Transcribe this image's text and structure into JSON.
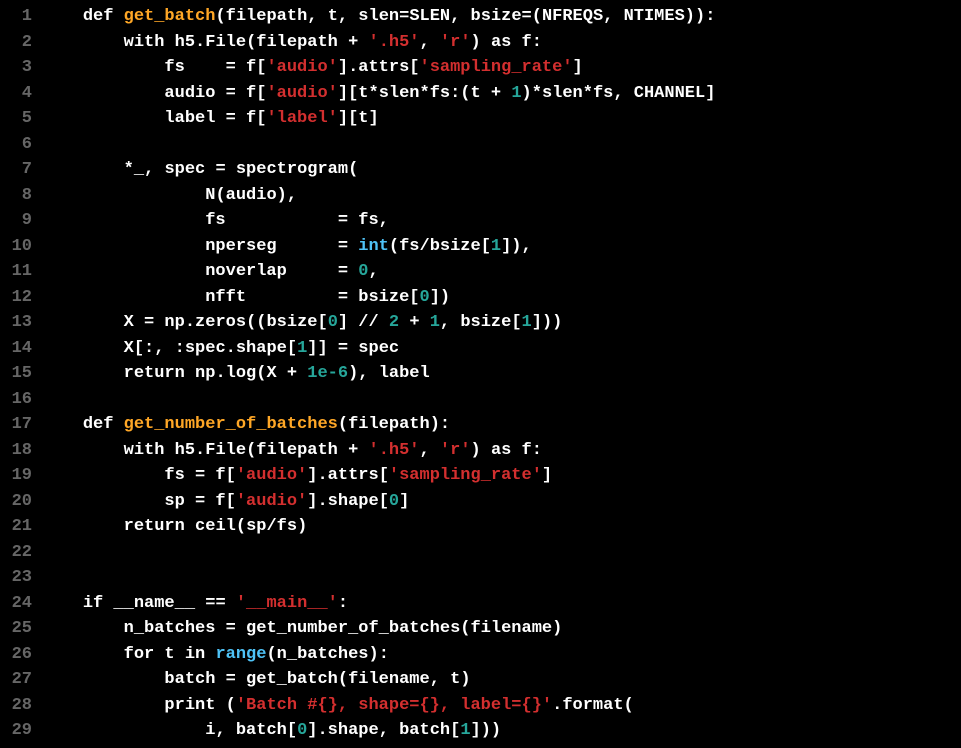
{
  "lines": [
    {
      "n": "1",
      "tokens": [
        {
          "c": "id",
          "t": "    "
        },
        {
          "c": "kw",
          "t": "def"
        },
        {
          "c": "id",
          "t": " "
        },
        {
          "c": "fn",
          "t": "get_batch"
        },
        {
          "c": "punc",
          "t": "("
        },
        {
          "c": "id",
          "t": "filepath"
        },
        {
          "c": "punc",
          "t": ", "
        },
        {
          "c": "id",
          "t": "t"
        },
        {
          "c": "punc",
          "t": ", "
        },
        {
          "c": "id",
          "t": "slen"
        },
        {
          "c": "op",
          "t": "="
        },
        {
          "c": "id",
          "t": "SLEN"
        },
        {
          "c": "punc",
          "t": ", "
        },
        {
          "c": "id",
          "t": "bsize"
        },
        {
          "c": "op",
          "t": "="
        },
        {
          "c": "punc",
          "t": "("
        },
        {
          "c": "id",
          "t": "NFREQS"
        },
        {
          "c": "punc",
          "t": ", "
        },
        {
          "c": "id",
          "t": "NTIMES"
        },
        {
          "c": "punc",
          "t": "))"
        },
        {
          "c": "punc",
          "t": ":"
        }
      ]
    },
    {
      "n": "2",
      "tokens": [
        {
          "c": "id",
          "t": "        "
        },
        {
          "c": "kw",
          "t": "with"
        },
        {
          "c": "id",
          "t": " h5"
        },
        {
          "c": "punc",
          "t": "."
        },
        {
          "c": "id",
          "t": "File"
        },
        {
          "c": "punc",
          "t": "("
        },
        {
          "c": "id",
          "t": "filepath "
        },
        {
          "c": "op",
          "t": "+"
        },
        {
          "c": "id",
          "t": " "
        },
        {
          "c": "str",
          "t": "'.h5'"
        },
        {
          "c": "punc",
          "t": ", "
        },
        {
          "c": "str",
          "t": "'r'"
        },
        {
          "c": "punc",
          "t": ") "
        },
        {
          "c": "kw",
          "t": "as"
        },
        {
          "c": "id",
          "t": " f"
        },
        {
          "c": "punc",
          "t": ":"
        }
      ]
    },
    {
      "n": "3",
      "tokens": [
        {
          "c": "id",
          "t": "            fs    "
        },
        {
          "c": "op",
          "t": "="
        },
        {
          "c": "id",
          "t": " f"
        },
        {
          "c": "punc",
          "t": "["
        },
        {
          "c": "str",
          "t": "'audio'"
        },
        {
          "c": "punc",
          "t": "]"
        },
        {
          "c": "punc",
          "t": "."
        },
        {
          "c": "id",
          "t": "attrs"
        },
        {
          "c": "punc",
          "t": "["
        },
        {
          "c": "str",
          "t": "'sampling_rate'"
        },
        {
          "c": "punc",
          "t": "]"
        }
      ]
    },
    {
      "n": "4",
      "tokens": [
        {
          "c": "id",
          "t": "            audio "
        },
        {
          "c": "op",
          "t": "="
        },
        {
          "c": "id",
          "t": " f"
        },
        {
          "c": "punc",
          "t": "["
        },
        {
          "c": "str",
          "t": "'audio'"
        },
        {
          "c": "punc",
          "t": "]["
        },
        {
          "c": "id",
          "t": "t"
        },
        {
          "c": "op",
          "t": "*"
        },
        {
          "c": "id",
          "t": "slen"
        },
        {
          "c": "op",
          "t": "*"
        },
        {
          "c": "id",
          "t": "fs"
        },
        {
          "c": "punc",
          "t": ":("
        },
        {
          "c": "id",
          "t": "t "
        },
        {
          "c": "op",
          "t": "+"
        },
        {
          "c": "id",
          "t": " "
        },
        {
          "c": "num",
          "t": "1"
        },
        {
          "c": "punc",
          "t": ")"
        },
        {
          "c": "op",
          "t": "*"
        },
        {
          "c": "id",
          "t": "slen"
        },
        {
          "c": "op",
          "t": "*"
        },
        {
          "c": "id",
          "t": "fs"
        },
        {
          "c": "punc",
          "t": ", "
        },
        {
          "c": "id",
          "t": "CHANNEL"
        },
        {
          "c": "punc",
          "t": "]"
        }
      ]
    },
    {
      "n": "5",
      "tokens": [
        {
          "c": "id",
          "t": "            label "
        },
        {
          "c": "op",
          "t": "="
        },
        {
          "c": "id",
          "t": " f"
        },
        {
          "c": "punc",
          "t": "["
        },
        {
          "c": "str",
          "t": "'label'"
        },
        {
          "c": "punc",
          "t": "]["
        },
        {
          "c": "id",
          "t": "t"
        },
        {
          "c": "punc",
          "t": "]"
        }
      ]
    },
    {
      "n": "6",
      "tokens": [
        {
          "c": "id",
          "t": " "
        }
      ]
    },
    {
      "n": "7",
      "tokens": [
        {
          "c": "id",
          "t": "        "
        },
        {
          "c": "op",
          "t": "*"
        },
        {
          "c": "id",
          "t": "_"
        },
        {
          "c": "punc",
          "t": ", "
        },
        {
          "c": "id",
          "t": "spec "
        },
        {
          "c": "op",
          "t": "="
        },
        {
          "c": "id",
          "t": " spectrogram"
        },
        {
          "c": "punc",
          "t": "("
        }
      ]
    },
    {
      "n": "8",
      "tokens": [
        {
          "c": "id",
          "t": "                N"
        },
        {
          "c": "punc",
          "t": "("
        },
        {
          "c": "id",
          "t": "audio"
        },
        {
          "c": "punc",
          "t": "),"
        }
      ]
    },
    {
      "n": "9",
      "tokens": [
        {
          "c": "id",
          "t": "                fs           "
        },
        {
          "c": "op",
          "t": "="
        },
        {
          "c": "id",
          "t": " fs"
        },
        {
          "c": "punc",
          "t": ","
        }
      ]
    },
    {
      "n": "10",
      "tokens": [
        {
          "c": "id",
          "t": "                nperseg      "
        },
        {
          "c": "op",
          "t": "="
        },
        {
          "c": "id",
          "t": " "
        },
        {
          "c": "bi",
          "t": "int"
        },
        {
          "c": "punc",
          "t": "("
        },
        {
          "c": "id",
          "t": "fs"
        },
        {
          "c": "op",
          "t": "/"
        },
        {
          "c": "id",
          "t": "bsize"
        },
        {
          "c": "punc",
          "t": "["
        },
        {
          "c": "num",
          "t": "1"
        },
        {
          "c": "punc",
          "t": "]),"
        }
      ]
    },
    {
      "n": "11",
      "tokens": [
        {
          "c": "id",
          "t": "                noverlap     "
        },
        {
          "c": "op",
          "t": "="
        },
        {
          "c": "id",
          "t": " "
        },
        {
          "c": "num",
          "t": "0"
        },
        {
          "c": "punc",
          "t": ","
        }
      ]
    },
    {
      "n": "12",
      "tokens": [
        {
          "c": "id",
          "t": "                nfft         "
        },
        {
          "c": "op",
          "t": "="
        },
        {
          "c": "id",
          "t": " bsize"
        },
        {
          "c": "punc",
          "t": "["
        },
        {
          "c": "num",
          "t": "0"
        },
        {
          "c": "punc",
          "t": "])"
        }
      ]
    },
    {
      "n": "13",
      "tokens": [
        {
          "c": "id",
          "t": "        X "
        },
        {
          "c": "op",
          "t": "="
        },
        {
          "c": "id",
          "t": " np"
        },
        {
          "c": "punc",
          "t": "."
        },
        {
          "c": "id",
          "t": "zeros"
        },
        {
          "c": "punc",
          "t": "(("
        },
        {
          "c": "id",
          "t": "bsize"
        },
        {
          "c": "punc",
          "t": "["
        },
        {
          "c": "num",
          "t": "0"
        },
        {
          "c": "punc",
          "t": "] "
        },
        {
          "c": "op",
          "t": "//"
        },
        {
          "c": "id",
          "t": " "
        },
        {
          "c": "num",
          "t": "2"
        },
        {
          "c": "id",
          "t": " "
        },
        {
          "c": "op",
          "t": "+"
        },
        {
          "c": "id",
          "t": " "
        },
        {
          "c": "num",
          "t": "1"
        },
        {
          "c": "punc",
          "t": ", "
        },
        {
          "c": "id",
          "t": "bsize"
        },
        {
          "c": "punc",
          "t": "["
        },
        {
          "c": "num",
          "t": "1"
        },
        {
          "c": "punc",
          "t": "]))"
        }
      ]
    },
    {
      "n": "14",
      "tokens": [
        {
          "c": "id",
          "t": "        X"
        },
        {
          "c": "punc",
          "t": "[:, :"
        },
        {
          "c": "id",
          "t": "spec"
        },
        {
          "c": "punc",
          "t": "."
        },
        {
          "c": "id",
          "t": "shape"
        },
        {
          "c": "punc",
          "t": "["
        },
        {
          "c": "num",
          "t": "1"
        },
        {
          "c": "punc",
          "t": "]] "
        },
        {
          "c": "op",
          "t": "="
        },
        {
          "c": "id",
          "t": " spec"
        }
      ]
    },
    {
      "n": "15",
      "tokens": [
        {
          "c": "id",
          "t": "        "
        },
        {
          "c": "kw",
          "t": "return"
        },
        {
          "c": "id",
          "t": " np"
        },
        {
          "c": "punc",
          "t": "."
        },
        {
          "c": "id",
          "t": "log"
        },
        {
          "c": "punc",
          "t": "("
        },
        {
          "c": "id",
          "t": "X "
        },
        {
          "c": "op",
          "t": "+"
        },
        {
          "c": "id",
          "t": " "
        },
        {
          "c": "num",
          "t": "1e-6"
        },
        {
          "c": "punc",
          "t": "), "
        },
        {
          "c": "id",
          "t": "label"
        }
      ]
    },
    {
      "n": "16",
      "tokens": [
        {
          "c": "id",
          "t": " "
        }
      ]
    },
    {
      "n": "17",
      "tokens": [
        {
          "c": "id",
          "t": "    "
        },
        {
          "c": "kw",
          "t": "def"
        },
        {
          "c": "id",
          "t": " "
        },
        {
          "c": "fn",
          "t": "get_number_of_batches"
        },
        {
          "c": "punc",
          "t": "("
        },
        {
          "c": "id",
          "t": "filepath"
        },
        {
          "c": "punc",
          "t": "):"
        }
      ]
    },
    {
      "n": "18",
      "tokens": [
        {
          "c": "id",
          "t": "        "
        },
        {
          "c": "kw",
          "t": "with"
        },
        {
          "c": "id",
          "t": " h5"
        },
        {
          "c": "punc",
          "t": "."
        },
        {
          "c": "id",
          "t": "File"
        },
        {
          "c": "punc",
          "t": "("
        },
        {
          "c": "id",
          "t": "filepath "
        },
        {
          "c": "op",
          "t": "+"
        },
        {
          "c": "id",
          "t": " "
        },
        {
          "c": "str",
          "t": "'.h5'"
        },
        {
          "c": "punc",
          "t": ", "
        },
        {
          "c": "str",
          "t": "'r'"
        },
        {
          "c": "punc",
          "t": ") "
        },
        {
          "c": "kw",
          "t": "as"
        },
        {
          "c": "id",
          "t": " f"
        },
        {
          "c": "punc",
          "t": ":"
        }
      ]
    },
    {
      "n": "19",
      "tokens": [
        {
          "c": "id",
          "t": "            fs "
        },
        {
          "c": "op",
          "t": "="
        },
        {
          "c": "id",
          "t": " f"
        },
        {
          "c": "punc",
          "t": "["
        },
        {
          "c": "str",
          "t": "'audio'"
        },
        {
          "c": "punc",
          "t": "]."
        },
        {
          "c": "id",
          "t": "attrs"
        },
        {
          "c": "punc",
          "t": "["
        },
        {
          "c": "str",
          "t": "'sampling_rate'"
        },
        {
          "c": "punc",
          "t": "]"
        }
      ]
    },
    {
      "n": "20",
      "tokens": [
        {
          "c": "id",
          "t": "            sp "
        },
        {
          "c": "op",
          "t": "="
        },
        {
          "c": "id",
          "t": " f"
        },
        {
          "c": "punc",
          "t": "["
        },
        {
          "c": "str",
          "t": "'audio'"
        },
        {
          "c": "punc",
          "t": "]."
        },
        {
          "c": "id",
          "t": "shape"
        },
        {
          "c": "punc",
          "t": "["
        },
        {
          "c": "num",
          "t": "0"
        },
        {
          "c": "punc",
          "t": "]"
        }
      ]
    },
    {
      "n": "21",
      "tokens": [
        {
          "c": "id",
          "t": "        "
        },
        {
          "c": "kw",
          "t": "return"
        },
        {
          "c": "id",
          "t": " ceil"
        },
        {
          "c": "punc",
          "t": "("
        },
        {
          "c": "id",
          "t": "sp"
        },
        {
          "c": "op",
          "t": "/"
        },
        {
          "c": "id",
          "t": "fs"
        },
        {
          "c": "punc",
          "t": ")"
        }
      ]
    },
    {
      "n": "22",
      "tokens": [
        {
          "c": "id",
          "t": " "
        }
      ]
    },
    {
      "n": "23",
      "tokens": [
        {
          "c": "id",
          "t": " "
        }
      ]
    },
    {
      "n": "24",
      "tokens": [
        {
          "c": "id",
          "t": "    "
        },
        {
          "c": "kw",
          "t": "if"
        },
        {
          "c": "id",
          "t": " __name__ "
        },
        {
          "c": "op",
          "t": "=="
        },
        {
          "c": "id",
          "t": " "
        },
        {
          "c": "str",
          "t": "'__main__'"
        },
        {
          "c": "punc",
          "t": ":"
        }
      ]
    },
    {
      "n": "25",
      "tokens": [
        {
          "c": "id",
          "t": "        n_batches "
        },
        {
          "c": "op",
          "t": "="
        },
        {
          "c": "id",
          "t": " get_number_of_batches"
        },
        {
          "c": "punc",
          "t": "("
        },
        {
          "c": "id",
          "t": "filename"
        },
        {
          "c": "punc",
          "t": ")"
        }
      ]
    },
    {
      "n": "26",
      "tokens": [
        {
          "c": "id",
          "t": "        "
        },
        {
          "c": "kw",
          "t": "for"
        },
        {
          "c": "id",
          "t": " t "
        },
        {
          "c": "kw",
          "t": "in"
        },
        {
          "c": "id",
          "t": " "
        },
        {
          "c": "bi",
          "t": "range"
        },
        {
          "c": "punc",
          "t": "("
        },
        {
          "c": "id",
          "t": "n_batches"
        },
        {
          "c": "punc",
          "t": "):"
        }
      ]
    },
    {
      "n": "27",
      "tokens": [
        {
          "c": "id",
          "t": "            batch "
        },
        {
          "c": "op",
          "t": "="
        },
        {
          "c": "id",
          "t": " get_batch"
        },
        {
          "c": "punc",
          "t": "("
        },
        {
          "c": "id",
          "t": "filename"
        },
        {
          "c": "punc",
          "t": ", "
        },
        {
          "c": "id",
          "t": "t"
        },
        {
          "c": "punc",
          "t": ")"
        }
      ]
    },
    {
      "n": "28",
      "tokens": [
        {
          "c": "id",
          "t": "            "
        },
        {
          "c": "kw",
          "t": "print"
        },
        {
          "c": "id",
          "t": " "
        },
        {
          "c": "punc",
          "t": "("
        },
        {
          "c": "str",
          "t": "'Batch #{}, shape={}, label={}'"
        },
        {
          "c": "punc",
          "t": "."
        },
        {
          "c": "id",
          "t": "format"
        },
        {
          "c": "punc",
          "t": "("
        }
      ]
    },
    {
      "n": "29",
      "tokens": [
        {
          "c": "id",
          "t": "                i"
        },
        {
          "c": "punc",
          "t": ", "
        },
        {
          "c": "id",
          "t": "batch"
        },
        {
          "c": "punc",
          "t": "["
        },
        {
          "c": "num",
          "t": "0"
        },
        {
          "c": "punc",
          "t": "]."
        },
        {
          "c": "id",
          "t": "shape"
        },
        {
          "c": "punc",
          "t": ", "
        },
        {
          "c": "id",
          "t": "batch"
        },
        {
          "c": "punc",
          "t": "["
        },
        {
          "c": "num",
          "t": "1"
        },
        {
          "c": "punc",
          "t": "]))"
        }
      ]
    }
  ]
}
